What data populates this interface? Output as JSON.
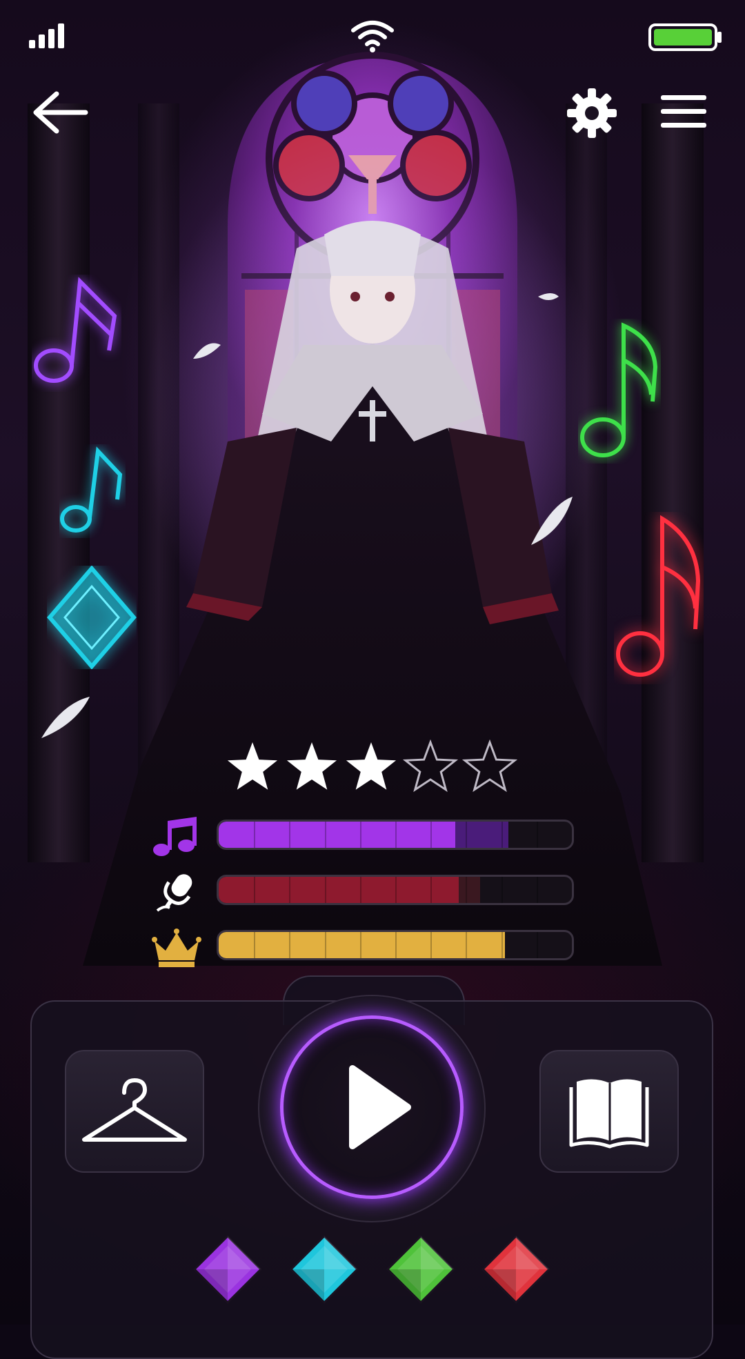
{
  "status": {
    "signal_icon": "signal-bars-icon",
    "wifi_icon": "wifi-icon",
    "battery_icon": "battery-icon",
    "battery_level": 1.0
  },
  "header": {
    "back_icon": "arrow-left-icon",
    "settings_icon": "gear-icon",
    "menu_icon": "hamburger-menu-icon"
  },
  "rating": {
    "value": 3,
    "max": 5
  },
  "stats": [
    {
      "icon": "music-note-icon",
      "color": "#a235e8",
      "fill": 0.67,
      "extra": 0.15,
      "extra_color": "#4a1c7a"
    },
    {
      "icon": "microphone-icon",
      "color": "#8e1a2e",
      "fill": 0.68,
      "extra": 0.06,
      "extra_color": "#3a1820"
    },
    {
      "icon": "crown-icon",
      "color": "#e2b040",
      "fill": 0.81,
      "extra": 0,
      "extra_color": "#000000"
    }
  ],
  "actions": {
    "wardrobe_icon": "hanger-icon",
    "play_icon": "play-icon",
    "story_icon": "book-icon"
  },
  "gems": [
    {
      "icon": "purple-gem-icon",
      "color": "#9a33e0"
    },
    {
      "icon": "cyan-gem-icon",
      "color": "#1fc6dc"
    },
    {
      "icon": "green-gem-icon",
      "color": "#4fc23a"
    },
    {
      "icon": "red-gem-icon",
      "color": "#e0333c"
    }
  ],
  "colors": {
    "accent": "#b75cff",
    "note_purple": "#a24cff",
    "note_cyan": "#1fd0e6",
    "note_green": "#3ee04a",
    "note_red": "#ff3040"
  }
}
